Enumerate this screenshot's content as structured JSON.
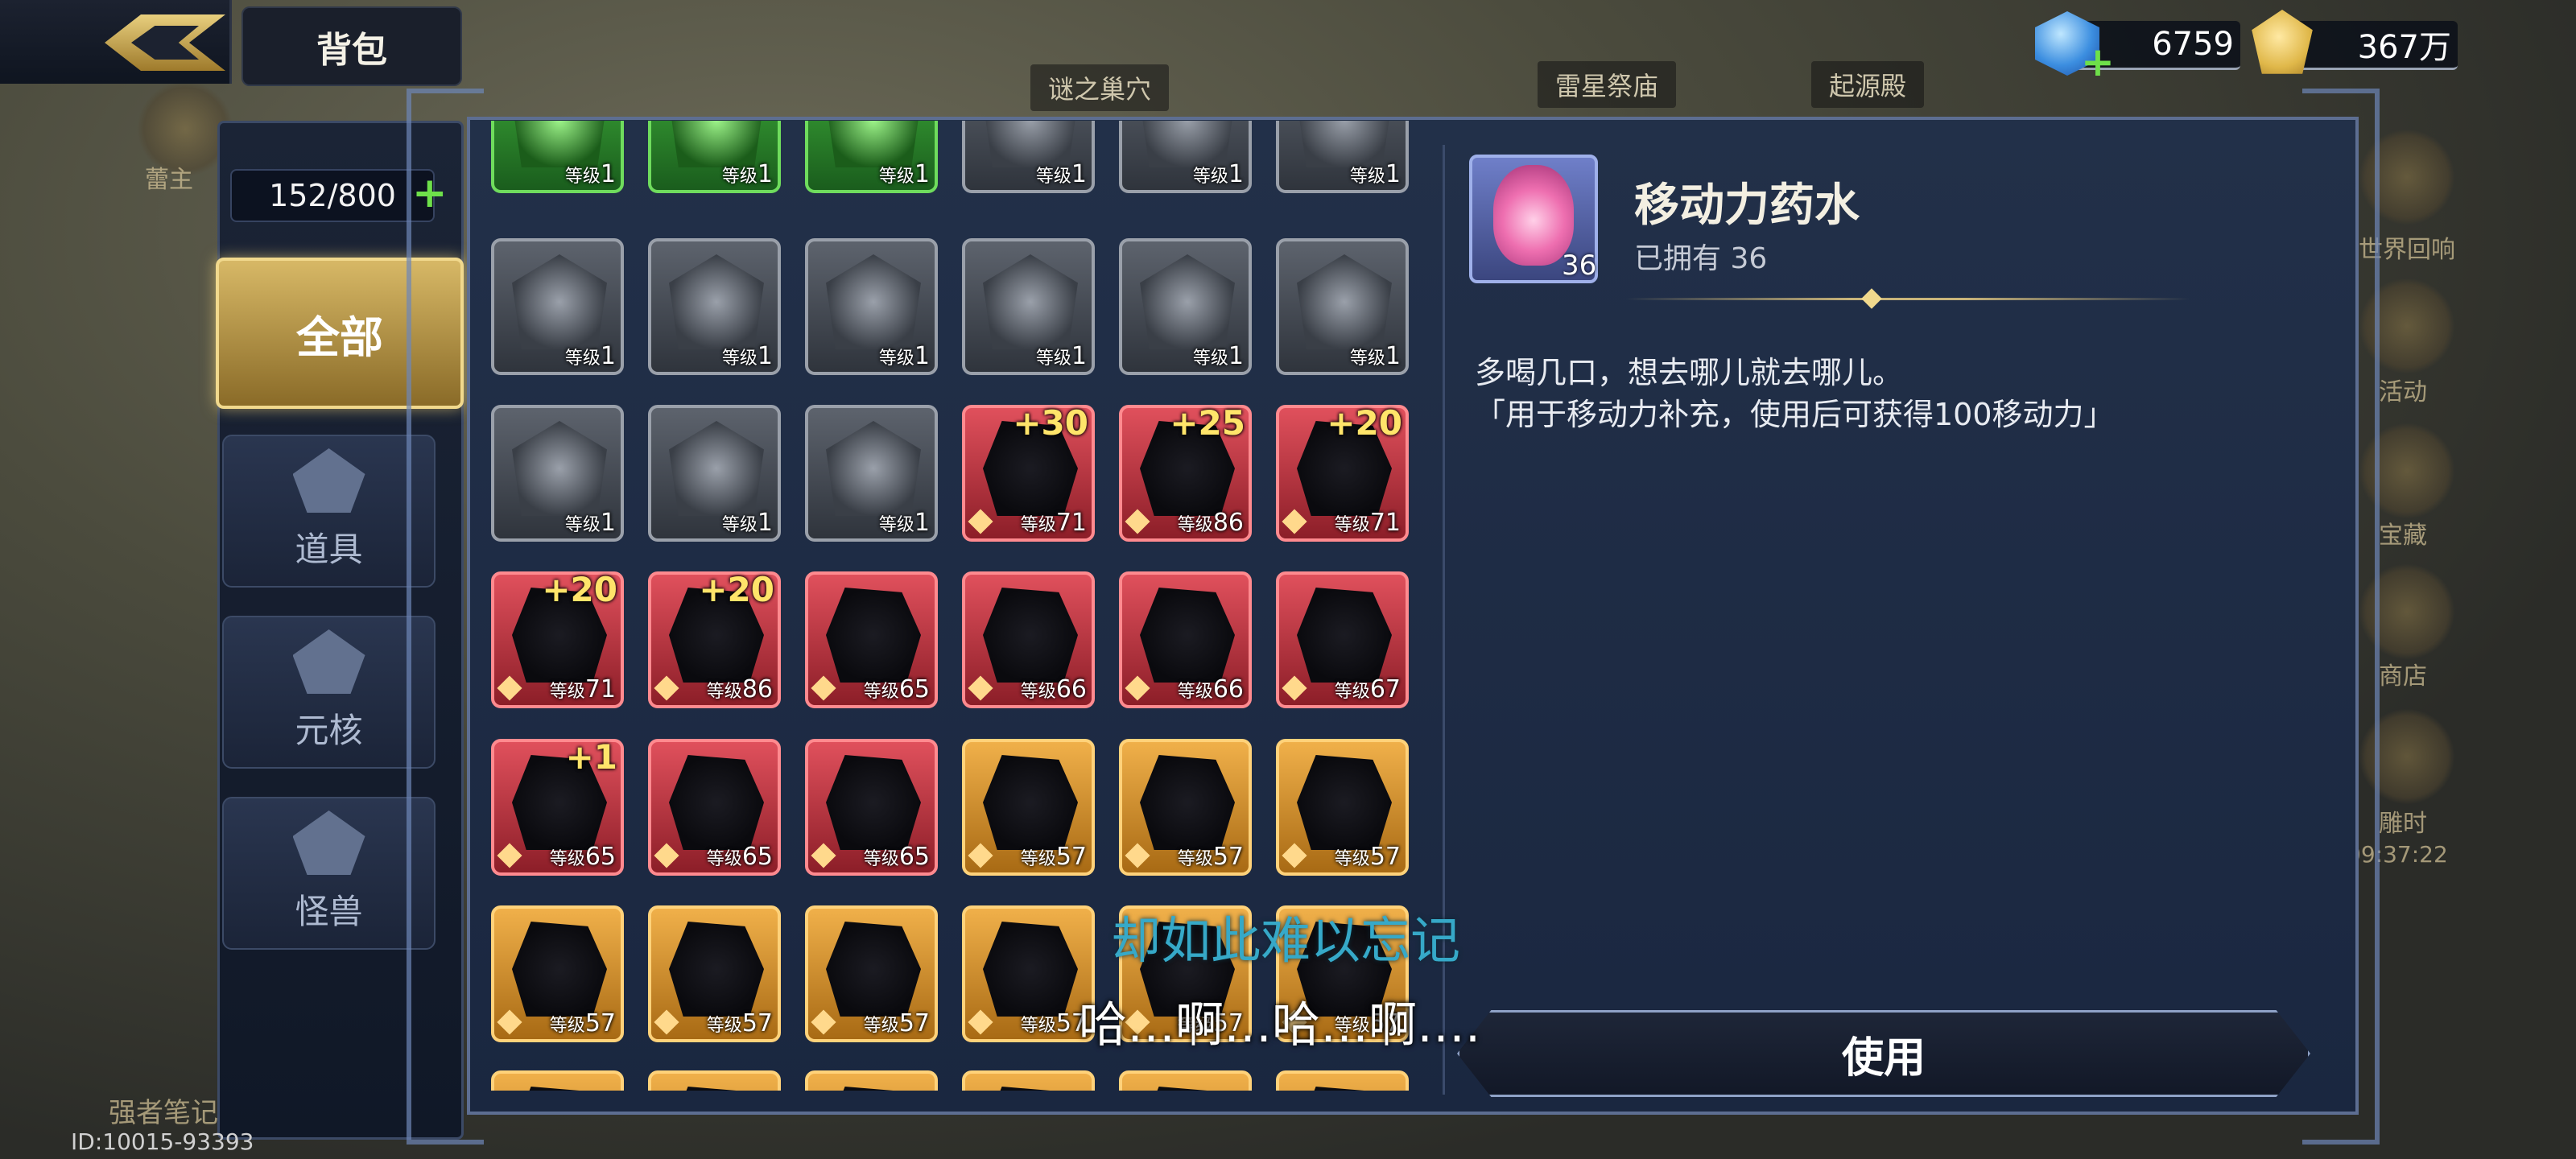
{
  "header": {
    "title": "背包",
    "gems": "6759",
    "gold": "367万"
  },
  "background": {
    "labels": [
      "谜之巢穴",
      "雷星祭庙",
      "起源殿"
    ],
    "right_labels": [
      "世界回响",
      "活动",
      "宝藏",
      "商店",
      "雕时"
    ],
    "left_labels": [
      "蕾主",
      "强者笔记"
    ],
    "timer": "09:37:22"
  },
  "inventory": {
    "capacity": "152/800",
    "categories": [
      {
        "id": "all",
        "label": "全部",
        "active": true
      },
      {
        "id": "items",
        "label": "道具"
      },
      {
        "id": "core",
        "label": "元核"
      },
      {
        "id": "beast",
        "label": "怪兽"
      }
    ],
    "level_prefix": "等级",
    "rows": [
      [
        {
          "c": "green",
          "lv": "1"
        },
        {
          "c": "green",
          "lv": "1"
        },
        {
          "c": "green",
          "lv": "1"
        },
        {
          "c": "gray",
          "lv": "1"
        },
        {
          "c": "gray",
          "lv": "1"
        },
        {
          "c": "gray",
          "lv": "1"
        }
      ],
      [
        {
          "c": "gray",
          "lv": "1"
        },
        {
          "c": "gray",
          "lv": "1"
        },
        {
          "c": "gray",
          "lv": "1"
        },
        {
          "c": "gray",
          "lv": "1"
        },
        {
          "c": "gray",
          "lv": "1"
        },
        {
          "c": "gray",
          "lv": "1"
        }
      ],
      [
        {
          "c": "gray",
          "lv": "1"
        },
        {
          "c": "gray",
          "lv": "1"
        },
        {
          "c": "gray",
          "lv": "1"
        },
        {
          "c": "red",
          "lv": "71",
          "plus": "+30"
        },
        {
          "c": "red",
          "lv": "86",
          "plus": "+25"
        },
        {
          "c": "red",
          "lv": "71",
          "plus": "+20"
        }
      ],
      [
        {
          "c": "red",
          "lv": "71",
          "plus": "+20"
        },
        {
          "c": "red",
          "lv": "86",
          "plus": "+20"
        },
        {
          "c": "red",
          "lv": "65"
        },
        {
          "c": "red",
          "lv": "66"
        },
        {
          "c": "red",
          "lv": "66"
        },
        {
          "c": "red",
          "lv": "67"
        }
      ],
      [
        {
          "c": "red",
          "lv": "65",
          "plus": "+1"
        },
        {
          "c": "red",
          "lv": "65"
        },
        {
          "c": "red",
          "lv": "65"
        },
        {
          "c": "orange",
          "lv": "57"
        },
        {
          "c": "orange",
          "lv": "57"
        },
        {
          "c": "orange",
          "lv": "57"
        }
      ],
      [
        {
          "c": "orange",
          "lv": "57"
        },
        {
          "c": "orange",
          "lv": "57"
        },
        {
          "c": "orange",
          "lv": "57"
        },
        {
          "c": "orange",
          "lv": "57"
        },
        {
          "c": "orange",
          "lv": "57"
        },
        {
          "c": "orange",
          "lv": "57"
        }
      ],
      [
        {
          "c": "orange",
          "lv": ""
        },
        {
          "c": "orange",
          "lv": ""
        },
        {
          "c": "orange",
          "lv": ""
        },
        {
          "c": "orange",
          "lv": ""
        },
        {
          "c": "orange",
          "lv": ""
        },
        {
          "c": "orange",
          "lv": ""
        }
      ]
    ]
  },
  "detail": {
    "name": "移动力药水",
    "owned": "已拥有 36",
    "count": "36",
    "desc_line1": "多喝几口，想去哪儿就去哪儿。",
    "desc_line2": "「用于移动力补充，使用后可获得100移动力」",
    "use_label": "使用"
  },
  "subtitles": {
    "line1": "却如此难以忘记",
    "line2": "哈…啊…哈…啊…."
  },
  "footer": {
    "player_id": "ID:10015-93393"
  },
  "colors": {
    "accent_gold": "#d7b866",
    "gem_blue": "#3c8ee0",
    "plus_green": "#6ee04a",
    "rarity_red": "#e0505c",
    "rarity_orange": "#f0b04a",
    "rarity_green": "#3fae3a",
    "rarity_gray": "#5d636d"
  },
  "icons": [
    "back-arrow-icon",
    "gem-icon",
    "gold-coin-icon",
    "items-icon",
    "core-icon",
    "beast-icon",
    "potion-icon"
  ]
}
